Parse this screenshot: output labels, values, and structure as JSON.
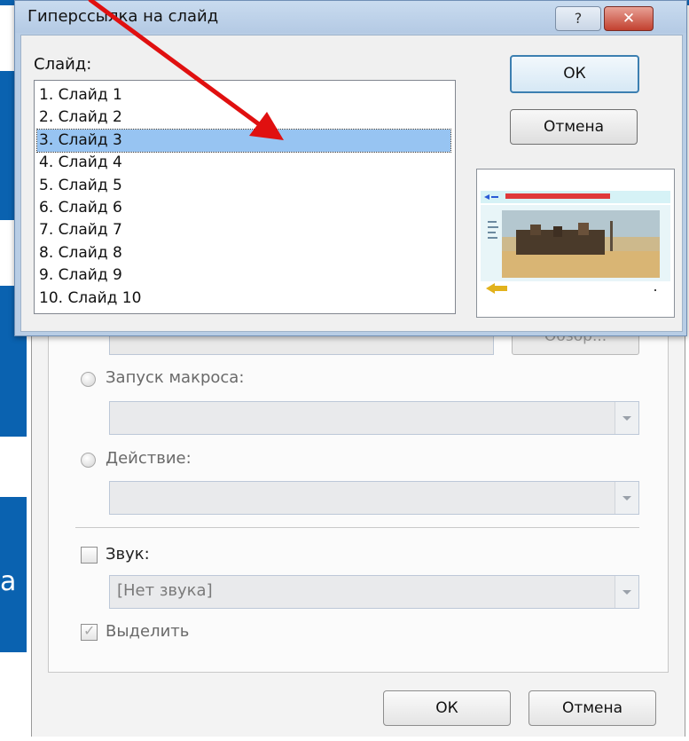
{
  "top_dialog": {
    "title": "Гиперссылка на слайд",
    "help_glyph": "?",
    "close_glyph": "✕",
    "slide_label": "Слайд:",
    "slides": [
      "1. Слайд 1",
      "2. Слайд 2",
      "3. Слайд 3",
      "4. Слайд 4",
      "5. Слайд 5",
      "6. Слайд 6",
      "7. Слайд 7",
      "8. Слайд 8",
      "9. Слайд 9",
      "10. Слайд 10"
    ],
    "selected_index": 2,
    "ok_label": "ОК",
    "cancel_label": "Отмена"
  },
  "under_dialog": {
    "browse_label": "Обзор...",
    "macro_label": "Запуск макроса:",
    "action_label": "Действие:",
    "sound_label": "Звук:",
    "sound_value": "[Нет звука]",
    "highlight_label": "Выделить",
    "highlight_checked": true,
    "ok_label": "ОК",
    "cancel_label": "Отмена"
  },
  "background": {
    "cut_text": "а"
  },
  "colors": {
    "selection": "#97c4f2",
    "annotation_arrow": "#e01010",
    "background_band": "#0a62b0"
  }
}
